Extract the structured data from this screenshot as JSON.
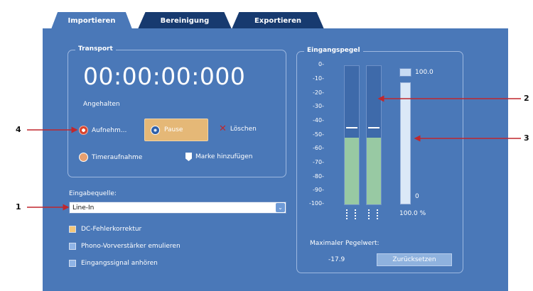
{
  "tabs": [
    {
      "label": "Importieren"
    },
    {
      "label": "Bereinigung"
    },
    {
      "label": "Exportieren"
    }
  ],
  "transport": {
    "title": "Transport",
    "time": "00:00:00:000",
    "status": "Angehalten",
    "record_label": "Aufnehm...",
    "pause_label": "Pause",
    "delete_label": "Löschen",
    "timer_label": "Timeraufnahme",
    "marker_label": "Marke hinzufügen"
  },
  "input": {
    "label": "Eingabequelle:",
    "value": "Line-In",
    "options": [
      {
        "label": "DC-Fehlerkorrektur",
        "checked": false
      },
      {
        "label": "Phono-Vorverstärker emulieren",
        "checked": false
      },
      {
        "label": "Eingangssignal anhören",
        "checked": false
      }
    ]
  },
  "level": {
    "title": "Eingangspegel",
    "scale": [
      "0-",
      "-10-",
      "-20-",
      "-30-",
      "-40-",
      "-50-",
      "-60-",
      "-70-",
      "-80-",
      "-90-",
      "-100-"
    ],
    "left_channel_level_db": -52,
    "right_channel_level_db": -52,
    "left_peak_db": -45,
    "right_peak_db": -45,
    "slider_max_label": "100.0",
    "slider_min_label": "0",
    "slider_value": "100.0 %",
    "max_level_label": "Maximaler Pegelwert:",
    "max_level_value": "-17.9",
    "reset_label": "Zurücksetzen"
  },
  "callouts": [
    "1",
    "2",
    "3",
    "4"
  ],
  "colors": {
    "panel": "#4a78b8",
    "tab_inactive": "#173a6f",
    "meter_fill": "#98c9a3",
    "pause_highlight": "#e5b877",
    "callout_arrow": "#c0272d"
  }
}
